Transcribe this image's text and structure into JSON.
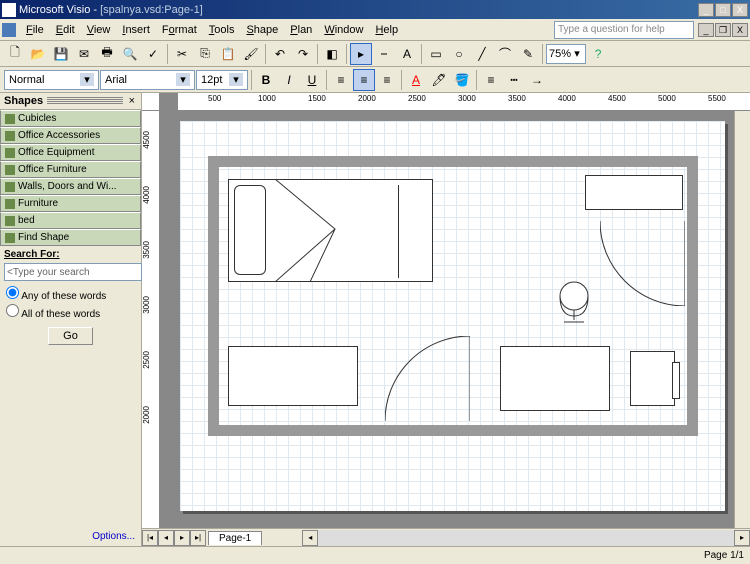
{
  "app": {
    "name": "Microsoft Visio",
    "doc": "[spalnya.vsd:Page-1]"
  },
  "menu": {
    "file": "File",
    "edit": "Edit",
    "view": "View",
    "insert": "Insert",
    "format": "Format",
    "tools": "Tools",
    "shape": "Shape",
    "plan": "Plan",
    "window": "Window",
    "help": "Help"
  },
  "helpbox": {
    "placeholder": "Type a question for help"
  },
  "format": {
    "style": "Normal",
    "font": "Arial",
    "size": "12pt"
  },
  "zoom": "75%",
  "shapes": {
    "title": "Shapes",
    "stencils": [
      "Cubicles",
      "Office Accessories",
      "Office Equipment",
      "Office Furniture",
      "Walls, Doors and Wi...",
      "Furniture",
      "bed",
      "Find Shape"
    ],
    "search_label": "Search For:",
    "search_placeholder": "<Type your search",
    "radio_any": "Any of these words",
    "radio_all": "All of these words",
    "go": "Go",
    "options": "Options..."
  },
  "ruler": {
    "h": [
      "500",
      "1000",
      "1500",
      "2000",
      "2500",
      "3000",
      "3500",
      "4000",
      "4500",
      "5000",
      "5500"
    ],
    "v": [
      "4500",
      "4000",
      "3500",
      "3000",
      "2500",
      "2000"
    ]
  },
  "tabs": {
    "page": "Page-1"
  },
  "status": {
    "page": "Page 1/1"
  }
}
